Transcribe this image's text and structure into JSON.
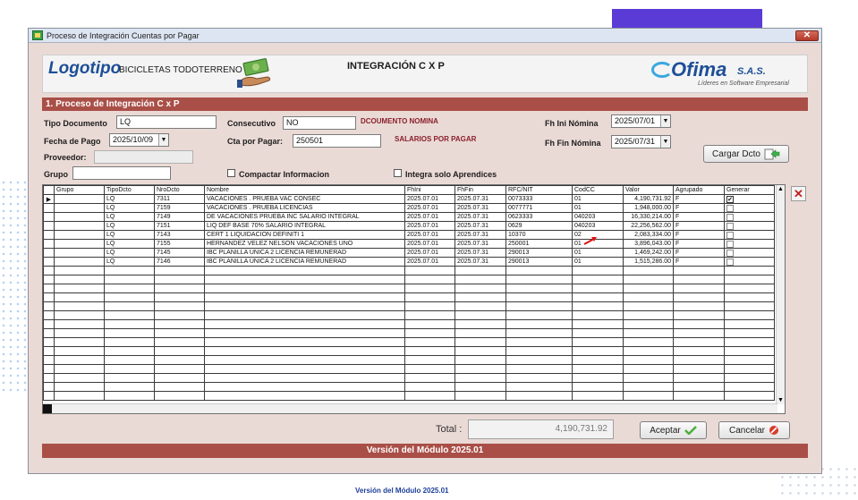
{
  "window": {
    "title": "Proceso de Integración Cuentas por Pagar",
    "close_label": "✕"
  },
  "banner": {
    "logo_text": "Logotipo",
    "company_name": "BICICLETAS TODOTERRENO",
    "title": "INTEGRACIÓN C X P",
    "ofima_name": "Ofima",
    "ofima_suffix": "S.A.S.",
    "ofima_tagline": "Líderes en Software Empresarial"
  },
  "section_title": "1. Proceso de Integración C x P",
  "form": {
    "tipo_documento_label": "Tipo Documento",
    "tipo_documento_value": "LQ",
    "consecutivo_label": "Consecutivo",
    "consecutivo_value": "NO",
    "consecutivo_desc": "DCOUMENTO NOMINA",
    "fh_ini_label": "Fh Ini Nómina",
    "fh_ini_value": "2025/07/01",
    "fecha_pago_label": "Fecha de Pago",
    "fecha_pago_value": "2025/10/09",
    "cta_label": "Cta por Pagar:",
    "cta_value": "250501",
    "cta_desc": "SALARIOS POR PAGAR",
    "fh_fin_label": "Fh Fin Nómina",
    "fh_fin_value": "2025/07/31",
    "proveedor_label": "Proveedor:",
    "proveedor_value": "",
    "grupo_label": "Grupo",
    "grupo_value": "",
    "compactar_label": "Compactar Informacion",
    "aprendices_label": "Integra solo Aprendices",
    "cargar_label": "Cargar Dcto"
  },
  "grid": {
    "columns": [
      "Grupo",
      "TipoDcto",
      "NroDcto",
      "Nombre",
      "FhIni",
      "FhFin",
      "RFC/NIT",
      "CodCC",
      "Valor",
      "Agrupado",
      "Generar"
    ],
    "rows": [
      {
        "grupo": "",
        "tipo": "LQ",
        "nro": "7311",
        "nombre": "VACACIONES . PRUEBA VAC CONSEC",
        "fhini": "2025.07.01",
        "fhfin": "2025.07.31",
        "nit": "0073333",
        "codcc": "01",
        "valor": "4,190,731.92",
        "agrupado": "F",
        "generar": true
      },
      {
        "grupo": "",
        "tipo": "LQ",
        "nro": "7159",
        "nombre": "VACACIONES . PRUEBA LICENCIAS",
        "fhini": "2025.07.01",
        "fhfin": "2025.07.31",
        "nit": "0077771",
        "codcc": "01",
        "valor": "1,948,000.00",
        "agrupado": "F",
        "generar": false
      },
      {
        "grupo": "",
        "tipo": "LQ",
        "nro": "7149",
        "nombre": "DE VACACIONES PRUEBA INC SALARIO INTEGRAL",
        "fhini": "2025.07.01",
        "fhfin": "2025.07.31",
        "nit": "0623333",
        "codcc": "040203",
        "valor": "16,330,214.00",
        "agrupado": "F",
        "generar": false
      },
      {
        "grupo": "",
        "tipo": "LQ",
        "nro": "7151",
        "nombre": "LIQ DEF BASE 70% SALARIO INTEGRAL",
        "fhini": "2025.07.01",
        "fhfin": "2025.07.31",
        "nit": "0629",
        "codcc": "040203",
        "valor": "22,256,562.00",
        "agrupado": "F",
        "generar": false
      },
      {
        "grupo": "",
        "tipo": "LQ",
        "nro": "7143",
        "nombre": "CERT 1 LIQUIDACION DEFINITI 1",
        "fhini": "2025.07.01",
        "fhfin": "2025.07.31",
        "nit": "10370",
        "codcc": "02",
        "valor": "2,083,334.00",
        "agrupado": "F",
        "generar": false
      },
      {
        "grupo": "",
        "tipo": "LQ",
        "nro": "7155",
        "nombre": "HERNANDEZ VELEZ NELSON VACACIONES UNO",
        "fhini": "2025.07.01",
        "fhfin": "2025.07.31",
        "nit": "250001",
        "codcc": "01",
        "valor": "3,896,043.00",
        "agrupado": "F",
        "generar": false
      },
      {
        "grupo": "",
        "tipo": "LQ",
        "nro": "7145",
        "nombre": "IBC PLANILLA UNICA 2 LICENCIA REMUNERAD",
        "fhini": "2025.07.01",
        "fhfin": "2025.07.31",
        "nit": "290013",
        "codcc": "01",
        "valor": "1,469,242.00",
        "agrupado": "F",
        "generar": false
      },
      {
        "grupo": "",
        "tipo": "LQ",
        "nro": "7146",
        "nombre": "IBC PLANILLA UNICA 2 LICENCIA REMUNERAD",
        "fhini": "2025.07.01",
        "fhfin": "2025.07.31",
        "nit": "290013",
        "codcc": "01",
        "valor": "1,515,286.00",
        "agrupado": "F",
        "generar": false
      }
    ],
    "empty_rows": 15
  },
  "totals": {
    "label": "Total :",
    "value": "4,190,731.92"
  },
  "buttons": {
    "aceptar": "Aceptar",
    "cancelar": "Cancelar"
  },
  "footer": {
    "version": "Versión del Módulo 2025.01"
  },
  "page_footer": {
    "version": "Versión del Módulo 2025.01"
  },
  "colors": {
    "header_bar": "#a94f47",
    "window_bg": "#eadad6",
    "brand_blue": "#1d4f97"
  }
}
